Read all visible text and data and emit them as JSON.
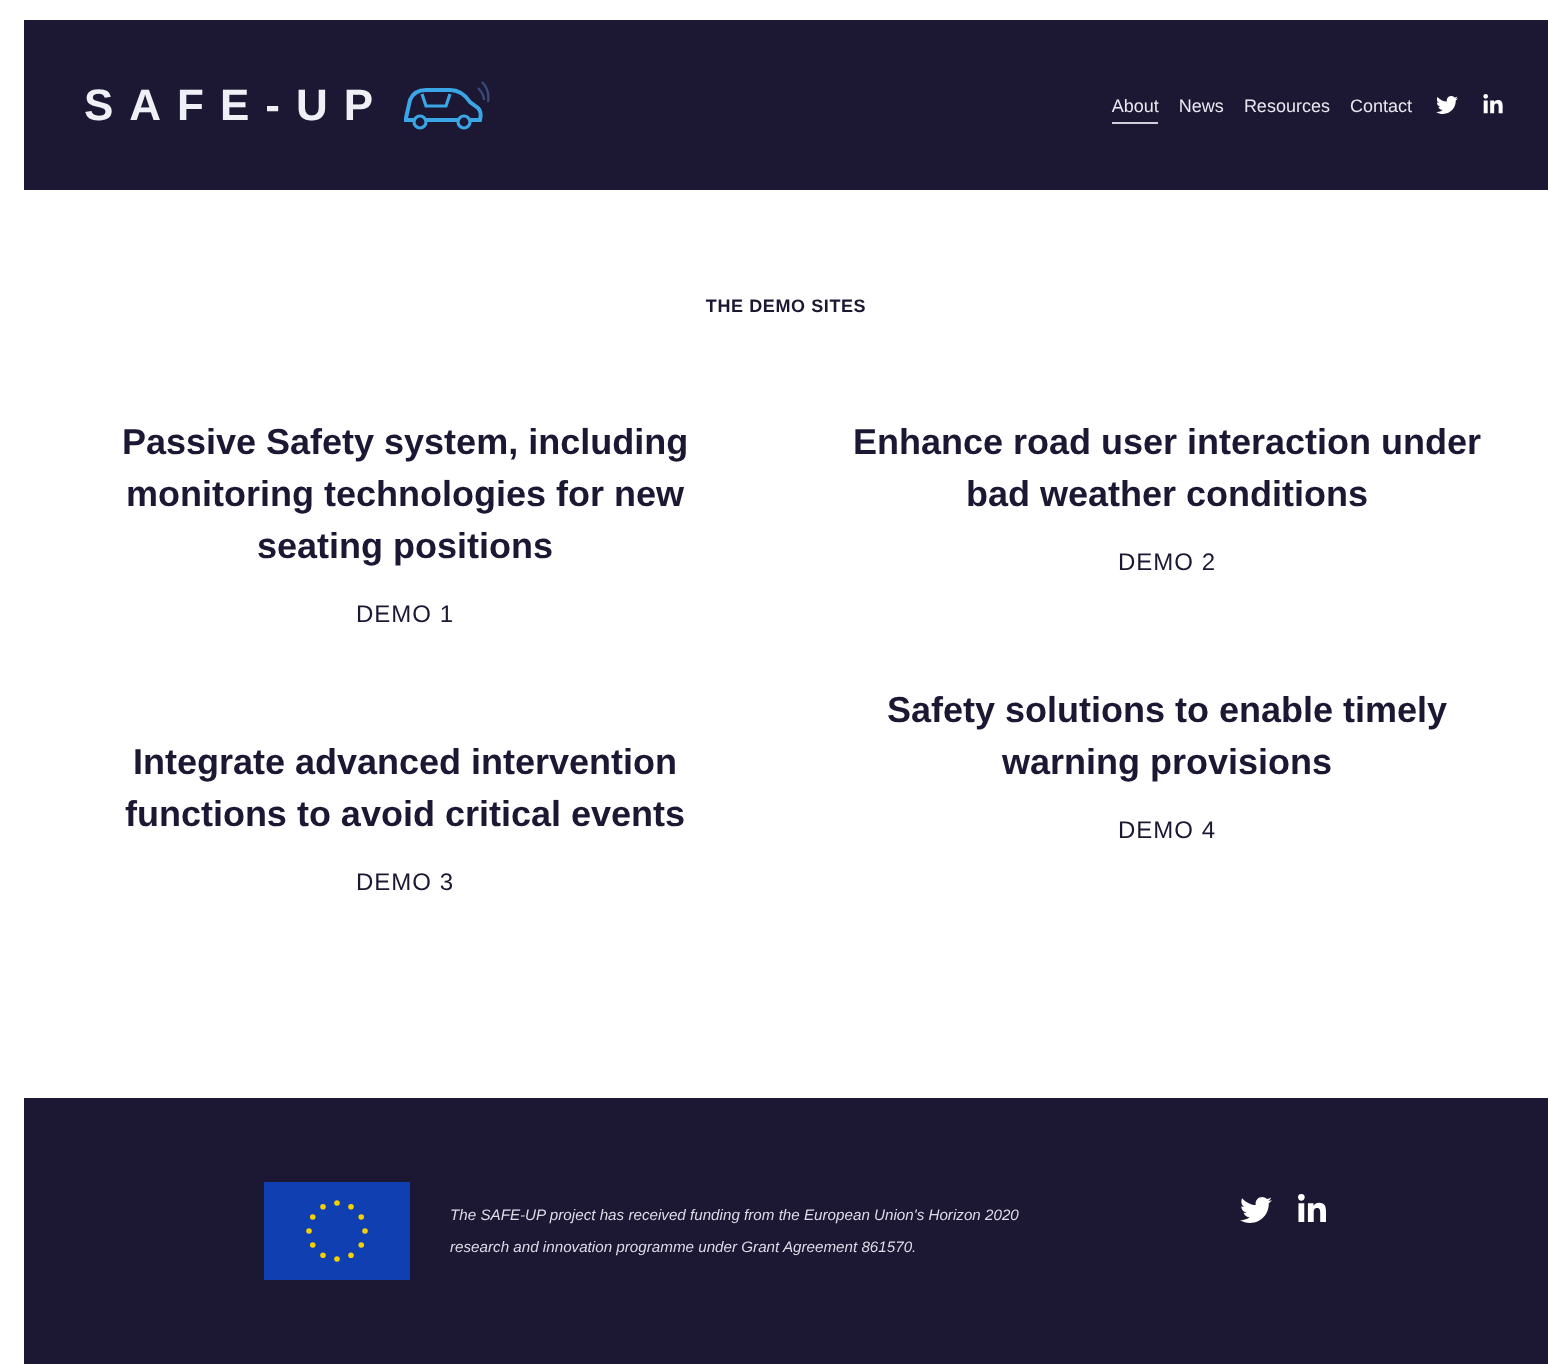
{
  "header": {
    "logo": "SAFE-UP",
    "nav": [
      {
        "label": "About",
        "selected": true
      },
      {
        "label": "News",
        "selected": false
      },
      {
        "label": "Resources",
        "selected": false
      },
      {
        "label": "Contact",
        "selected": false
      }
    ],
    "social": [
      {
        "kind": "twitter"
      },
      {
        "kind": "linkedin"
      }
    ]
  },
  "section": {
    "heading": "THE DEMO SITES",
    "columns": [
      [
        {
          "title": "Passive Safety system, including monitoring technologies for new seating positions",
          "label": "DEMO 1"
        },
        {
          "title": "Integrate advanced intervention functions to avoid critical events",
          "label": "DEMO 3"
        }
      ],
      [
        {
          "title": "Enhance road user interaction under bad weather conditions",
          "label": "DEMO 2"
        },
        {
          "title": "Safety solutions to enable timely warning provisions",
          "label": "DEMO 4"
        }
      ]
    ]
  },
  "footer": {
    "funding": "The SAFE-UP project has received funding from the European Union's Horizon 2020 research and innovation programme under Grant Agreement 861570.",
    "social": [
      {
        "kind": "twitter"
      },
      {
        "kind": "linkedin"
      }
    ]
  }
}
